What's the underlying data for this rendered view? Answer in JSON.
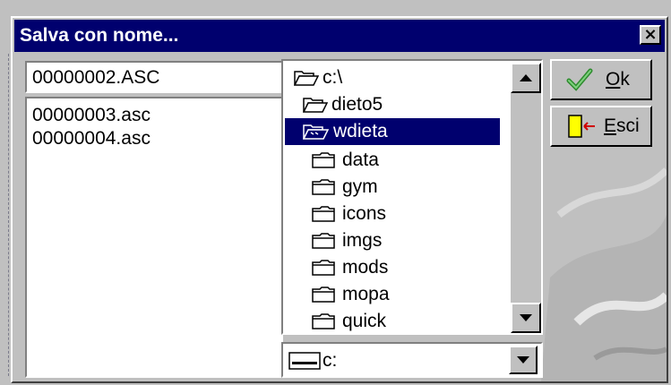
{
  "dialog": {
    "title": "Salva con nome...",
    "close_label": "×"
  },
  "filename": {
    "value": "00000002.ASC"
  },
  "files": [
    {
      "name": "00000003.asc"
    },
    {
      "name": "00000004.asc"
    }
  ],
  "folders": [
    {
      "name": "c:\\",
      "icon": "open-folder-icon",
      "selected": false
    },
    {
      "name": "dieto5",
      "icon": "open-folder-icon",
      "selected": false
    },
    {
      "name": "wdieta",
      "icon": "open-folder-icon",
      "selected": true
    },
    {
      "name": "data",
      "icon": "folder-icon",
      "selected": false
    },
    {
      "name": "gym",
      "icon": "folder-icon",
      "selected": false
    },
    {
      "name": "icons",
      "icon": "folder-icon",
      "selected": false
    },
    {
      "name": "imgs",
      "icon": "folder-icon",
      "selected": false
    },
    {
      "name": "mods",
      "icon": "folder-icon",
      "selected": false
    },
    {
      "name": "mopa",
      "icon": "folder-icon",
      "selected": false
    },
    {
      "name": "quick",
      "icon": "folder-icon",
      "selected": false
    }
  ],
  "drive": {
    "value": "c:",
    "icon": "drive-icon"
  },
  "buttons": {
    "ok": {
      "first": "O",
      "rest": "k",
      "icon": "checkmark-icon"
    },
    "cancel": {
      "first": "E",
      "rest": "sci",
      "icon": "exit-door-icon"
    }
  },
  "colors": {
    "title_bg": "#00006e",
    "selection_bg": "#00006e",
    "face": "#c0c0c0"
  }
}
